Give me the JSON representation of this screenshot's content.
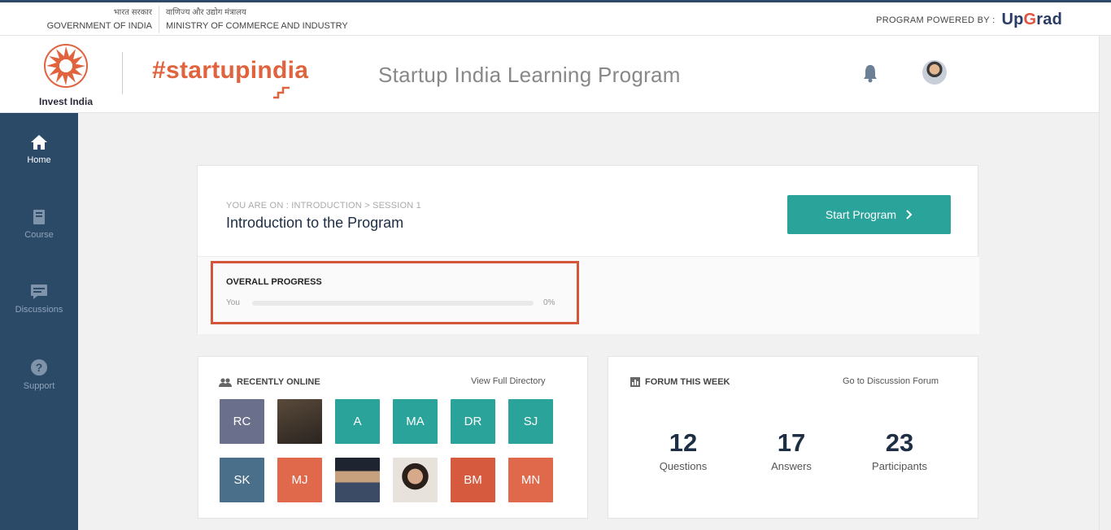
{
  "gov_bar": {
    "left_hindi": "भारत सरकार",
    "left_text": "GOVERNMENT OF INDIA",
    "right_hindi": "वाणिज्य और उद्योग मंत्रालय",
    "right_text": "MINISTRY OF COMMERCE AND INDUSTRY",
    "powered_label": "PROGRAM POWERED BY :",
    "powered_brand_a": "Up",
    "powered_brand_r": "G",
    "powered_brand_b": "rad"
  },
  "header": {
    "invest_india": "Invest India",
    "startupindia": "#startupindia",
    "program_title": "Startup India Learning Program"
  },
  "sidebar": {
    "items": [
      {
        "label": "Home",
        "icon": "home-icon",
        "active": true
      },
      {
        "label": "Course",
        "icon": "book-icon",
        "active": false
      },
      {
        "label": "Discussions",
        "icon": "discussion-icon",
        "active": false
      },
      {
        "label": "Support",
        "icon": "help-icon",
        "active": false
      }
    ]
  },
  "hero": {
    "breadcrumb": "YOU ARE ON : INTRODUCTION  >  SESSION 1",
    "title": "Introduction to the Program",
    "start_button": "Start Program",
    "progress_title": "OVERALL PROGRESS",
    "progress_you": "You",
    "progress_value": 0,
    "progress_pct_label": "0%"
  },
  "recently_online": {
    "title": "RECENTLY ONLINE",
    "link": "View Full Directory",
    "users": [
      {
        "initials": "RC",
        "color": "#6a6f8c"
      },
      {
        "initials": "",
        "color": "#3b3530",
        "photo": true
      },
      {
        "initials": "A",
        "color": "#2aa39a"
      },
      {
        "initials": "MA",
        "color": "#2aa39a"
      },
      {
        "initials": "DR",
        "color": "#2aa39a"
      },
      {
        "initials": "SJ",
        "color": "#2aa39a"
      },
      {
        "initials": "SK",
        "color": "#4a6f8a"
      },
      {
        "initials": "MJ",
        "color": "#e0694c"
      },
      {
        "initials": "",
        "color": "#2d3440",
        "photo": true
      },
      {
        "initials": "",
        "color": "#d9cfc7",
        "photo": true
      },
      {
        "initials": "BM",
        "color": "#d65a3e"
      },
      {
        "initials": "MN",
        "color": "#e0694c"
      }
    ]
  },
  "forum": {
    "title": "FORUM THIS WEEK",
    "link": "Go to Discussion Forum",
    "stats": [
      {
        "value": "12",
        "label": "Questions"
      },
      {
        "value": "17",
        "label": "Answers"
      },
      {
        "value": "23",
        "label": "Participants"
      }
    ]
  }
}
